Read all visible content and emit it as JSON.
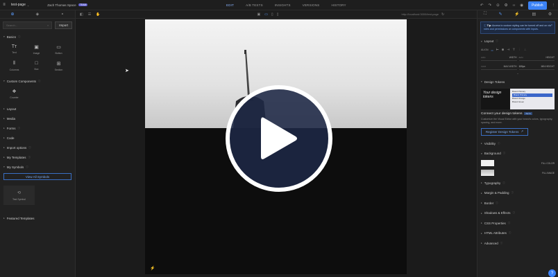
{
  "topbar": {
    "page_name": "test-page",
    "workspace": "Zach Thomas Space",
    "workspace_badge": "TEAM",
    "tabs": [
      {
        "label": "EDIT",
        "active": true
      },
      {
        "label": "A/B TESTS",
        "active": false
      },
      {
        "label": "INSIGHTS",
        "active": false
      },
      {
        "label": "VERSIONS",
        "active": false
      },
      {
        "label": "HISTORY",
        "active": false
      }
    ],
    "publish_label": "Publish"
  },
  "left_panel": {
    "search_placeholder": "Search...",
    "import_label": "Import",
    "sections": {
      "basics": "Basics",
      "custom_components": "Custom Components",
      "layout": "Layout",
      "media": "Media",
      "forms": "Forms",
      "code": "Code",
      "import_options": "Import options",
      "my_templates": "My Templates",
      "my_symbols": "My Symbols",
      "featured_templates": "Featured Templates"
    },
    "basics_tiles": [
      {
        "label": "Text",
        "icon": "text-icon"
      },
      {
        "label": "Image",
        "icon": "image-icon"
      },
      {
        "label": "Button",
        "icon": "button-icon"
      },
      {
        "label": "Columns",
        "icon": "columns-icon"
      },
      {
        "label": "Box",
        "icon": "box-icon"
      },
      {
        "label": "Section",
        "icon": "section-icon"
      }
    ],
    "custom_tile": {
      "label": "Counter",
      "icon": "counter-icon"
    },
    "view_all_symbols": "View All Symbols",
    "symbol_tile": {
      "label": "Test Symbol",
      "icon": "symbol-icon"
    }
  },
  "canvas": {
    "url": "http://localhost:3000/test-page"
  },
  "right_panel": {
    "tip": {
      "bold": "Tip:",
      "text": "Access to custom styling can be turned off and on via",
      "link1": "roles and permissions",
      "text2": "or",
      "link2": "components with Inputs",
      "end": "."
    },
    "layout_title": "Layout",
    "align_label": "ALIGN",
    "dims": [
      {
        "placeholder": "auto",
        "label": "WIDTH"
      },
      {
        "placeholder": "auto",
        "label": "HEIGHT"
      },
      {
        "placeholder": "none",
        "label": "MAX WIDTH"
      },
      {
        "placeholder": "100px",
        "label": "MIN HEIGHT"
      }
    ],
    "design_tokens_title": "Design Tokens",
    "tokens_image_text": "Your design tokens",
    "tokens_list": [
      "Brand Primary",
      "Brand Primary",
      "Brand Orange",
      "Brand Green"
    ],
    "connect_title": "Connect your design tokens",
    "beta": "BETA",
    "connect_desc": "Customize the Visual Editor with your brand's colors, typography, spacing, and more.",
    "register_label": "Register Design Tokens",
    "visibility_title": "Visibility",
    "background_title": "Background",
    "fill_color": "FILL COLOR",
    "fill_image": "FILL IMAGE",
    "typography_title": "Typography",
    "margin_padding_title": "Margin & Padding",
    "border_title": "Border",
    "shadows_title": "Shadows & Effects",
    "css_title": "CSS Properties",
    "html_attr_title": "HTML Attributes",
    "advanced_title": "Advanced"
  },
  "colors": {
    "accent": "#3b82f6",
    "panel": "#212121",
    "active_tab": "#8ab4ff"
  }
}
